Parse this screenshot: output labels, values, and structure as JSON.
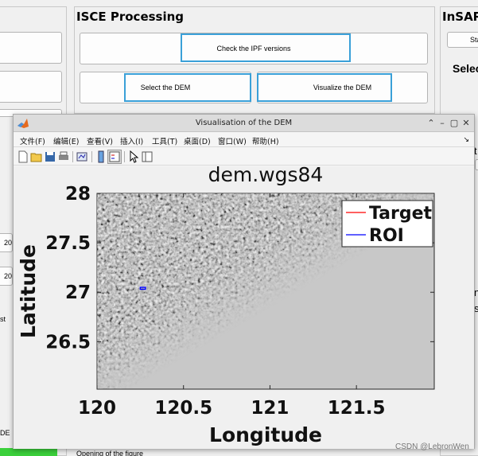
{
  "background": {
    "isce_panel": {
      "title": "ISCE Processing",
      "check_ipf_label": "Check the IPF versions",
      "select_dem_label": "Select the DEM",
      "visualize_dem_label": "Visualize the DEM"
    },
    "insar_panel": {
      "title": "InSAR",
      "tab_label": "Sta",
      "select_label": "Selec"
    },
    "left_stubs": [
      "20",
      "20",
      "st",
      "DE"
    ],
    "right_stubs": [
      "t",
      "n",
      "s"
    ],
    "status_message": "Opening of the figure"
  },
  "figure": {
    "window_title": "Visualisation of the DEM",
    "menu": [
      "文件(F)",
      "编辑(E)",
      "查看(V)",
      "插入(I)",
      "工具(T)",
      "桌面(D)",
      "窗口(W)",
      "帮助(H)"
    ],
    "toolbar_icons": [
      "new-figure-icon",
      "open-file-icon",
      "save-icon",
      "print-icon",
      "link-plot-icon",
      "colorbar-icon",
      "legend-icon",
      "pointer-icon",
      "property-editor-icon"
    ]
  },
  "chart_data": {
    "type": "heatmap",
    "title": "dem.wgs84",
    "xlabel": "Longitude",
    "ylabel": "Latitude",
    "xlim": [
      120,
      121.95
    ],
    "ylim": [
      26.02,
      28
    ],
    "xticks": [
      120,
      120.5,
      121,
      121.5
    ],
    "xtick_labels": [
      "120",
      "120.5",
      "121",
      "121.5"
    ],
    "yticks": [
      26.5,
      27,
      27.5,
      28
    ],
    "ytick_labels": [
      "26.5",
      "27",
      "27.5",
      "28"
    ],
    "grid": false,
    "legend": {
      "placement": "top-right",
      "entries": [
        {
          "name": "Target",
          "color": "#ff0000"
        },
        {
          "name": "ROI",
          "color": "#0000ff"
        }
      ]
    },
    "series": [
      {
        "name": "ROI",
        "type": "rectangle",
        "color": "#0000ff",
        "x": [
          120.25,
          120.28
        ],
        "y": [
          27.03,
          27.05
        ]
      }
    ],
    "colors": {
      "background": "#c8c8c8",
      "relief_dark": "#555555",
      "relief_light": "#f4f4f4"
    }
  },
  "watermark": "CSDN @LebronWen"
}
